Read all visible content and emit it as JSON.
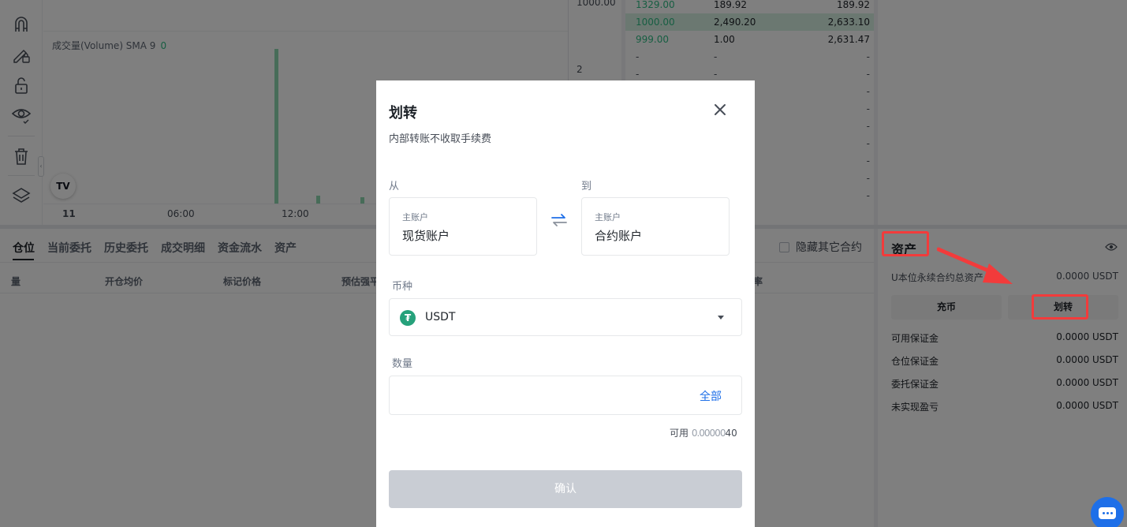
{
  "chart": {
    "volume_label": "成交量(Volume) SMA 9",
    "volume_value": "0",
    "time_labels": [
      "11",
      "06:00",
      "12:00"
    ],
    "price_labels": [
      "1000.00",
      "2"
    ],
    "tv_logo": "TV"
  },
  "orderbook": {
    "rows": [
      {
        "price": "1329.00",
        "amount": "189.92",
        "total": "189.92",
        "highlight": false
      },
      {
        "price": "1000.00",
        "amount": "2,490.20",
        "total": "2,633.10",
        "highlight": true
      },
      {
        "price": "999.00",
        "amount": "1.00",
        "total": "2,631.47",
        "highlight": false
      },
      {
        "price": "-",
        "amount": "-",
        "total": "-",
        "highlight": false
      },
      {
        "price": "-",
        "amount": "-",
        "total": "-",
        "highlight": false
      },
      {
        "price": "",
        "amount": "",
        "total": "-",
        "highlight": false
      },
      {
        "price": "",
        "amount": "",
        "total": "-",
        "highlight": false
      },
      {
        "price": "",
        "amount": "",
        "total": "-",
        "highlight": false
      },
      {
        "price": "",
        "amount": "",
        "total": "-",
        "highlight": false
      },
      {
        "price": "",
        "amount": "",
        "total": "-",
        "highlight": false
      },
      {
        "price": "",
        "amount": "",
        "total": "-",
        "highlight": false
      },
      {
        "price": "",
        "amount": "",
        "total": "-",
        "highlight": false
      }
    ]
  },
  "positions": {
    "tabs": [
      "仓位",
      "当前委托",
      "历史委托",
      "成交明细",
      "资金流水",
      "资产"
    ],
    "hide_other_label": "隐藏其它合约",
    "columns": [
      "量",
      "开仓均价",
      "标记价格",
      "预估强平",
      "率"
    ]
  },
  "assets": {
    "title": "资产",
    "total_label": "U本位永续合约总资产",
    "total_value": "0.0000 USDT",
    "deposit_label": "充币",
    "transfer_label": "划转",
    "rows": [
      {
        "label": "可用保证金",
        "value": "0.0000 USDT"
      },
      {
        "label": "仓位保证金",
        "value": "0.0000 USDT"
      },
      {
        "label": "委托保证金",
        "value": "0.0000 USDT"
      },
      {
        "label": "未实现盈亏",
        "value": "0.0000 USDT"
      }
    ]
  },
  "modal": {
    "title": "划转",
    "subtitle": "内部转账不收取手续费",
    "from_label": "从",
    "to_label": "到",
    "from_account_small": "主账户",
    "from_account": "现货账户",
    "to_account_small": "主账户",
    "to_account": "合约账户",
    "coin_label": "币种",
    "coin_symbol": "₮",
    "coin_value": "USDT",
    "amount_label": "数量",
    "amount_value": "",
    "amount_placeholder": "",
    "all_label": "全部",
    "available_prefix": "可用 ",
    "available_mask": "0.00000",
    "available_suffix": "40",
    "confirm_label": "确认"
  },
  "colors": {
    "accent_blue": "#1e6fe8",
    "buy_green": "#2ebd85",
    "annotation_red": "#f23b3b",
    "usdt_green": "#26a17b"
  }
}
